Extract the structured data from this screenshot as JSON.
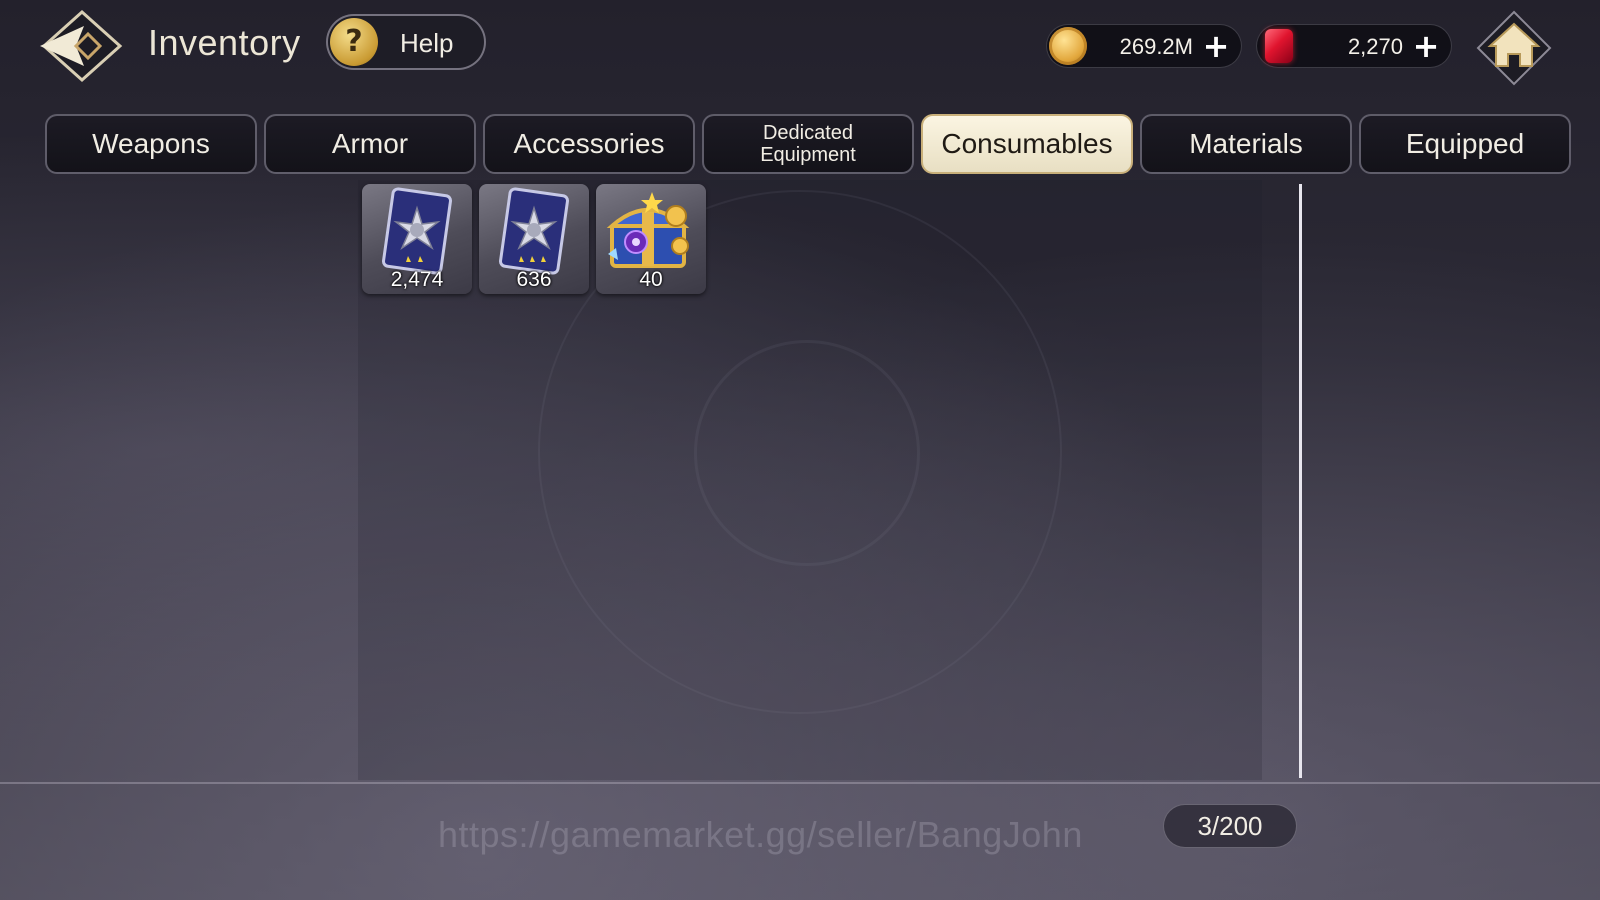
{
  "header": {
    "title": "Inventory",
    "help_label": "Help",
    "help_icon_glyph": "?"
  },
  "currencies": {
    "gold": {
      "value": "269.2M",
      "icon": "gold-coin-icon",
      "plus": "+"
    },
    "gems": {
      "value": "2,270",
      "icon": "ruby-gem-icon",
      "plus": "+"
    }
  },
  "tabs": [
    {
      "label": "Weapons",
      "active": false
    },
    {
      "label": "Armor",
      "active": false
    },
    {
      "label": "Accessories",
      "active": false
    },
    {
      "label": "Dedicated",
      "label2": "Equipment",
      "active": false
    },
    {
      "label": "Consumables",
      "active": true
    },
    {
      "label": "Materials",
      "active": false
    },
    {
      "label": "Equipped",
      "active": false
    }
  ],
  "items": [
    {
      "icon": "star-card-2star-icon",
      "count": "2,474"
    },
    {
      "icon": "star-card-3star-icon",
      "count": "636"
    },
    {
      "icon": "treasure-chest-icon",
      "count": "40"
    }
  ],
  "capacity": "3/200",
  "watermark": "https://gamemarket.gg/seller/BangJohn",
  "colors": {
    "active_tab_bg": "#fbf5e2",
    "tab_bg": "#1c1b24",
    "accent_gold": "#c99a32",
    "ruby": "#e0142e"
  }
}
